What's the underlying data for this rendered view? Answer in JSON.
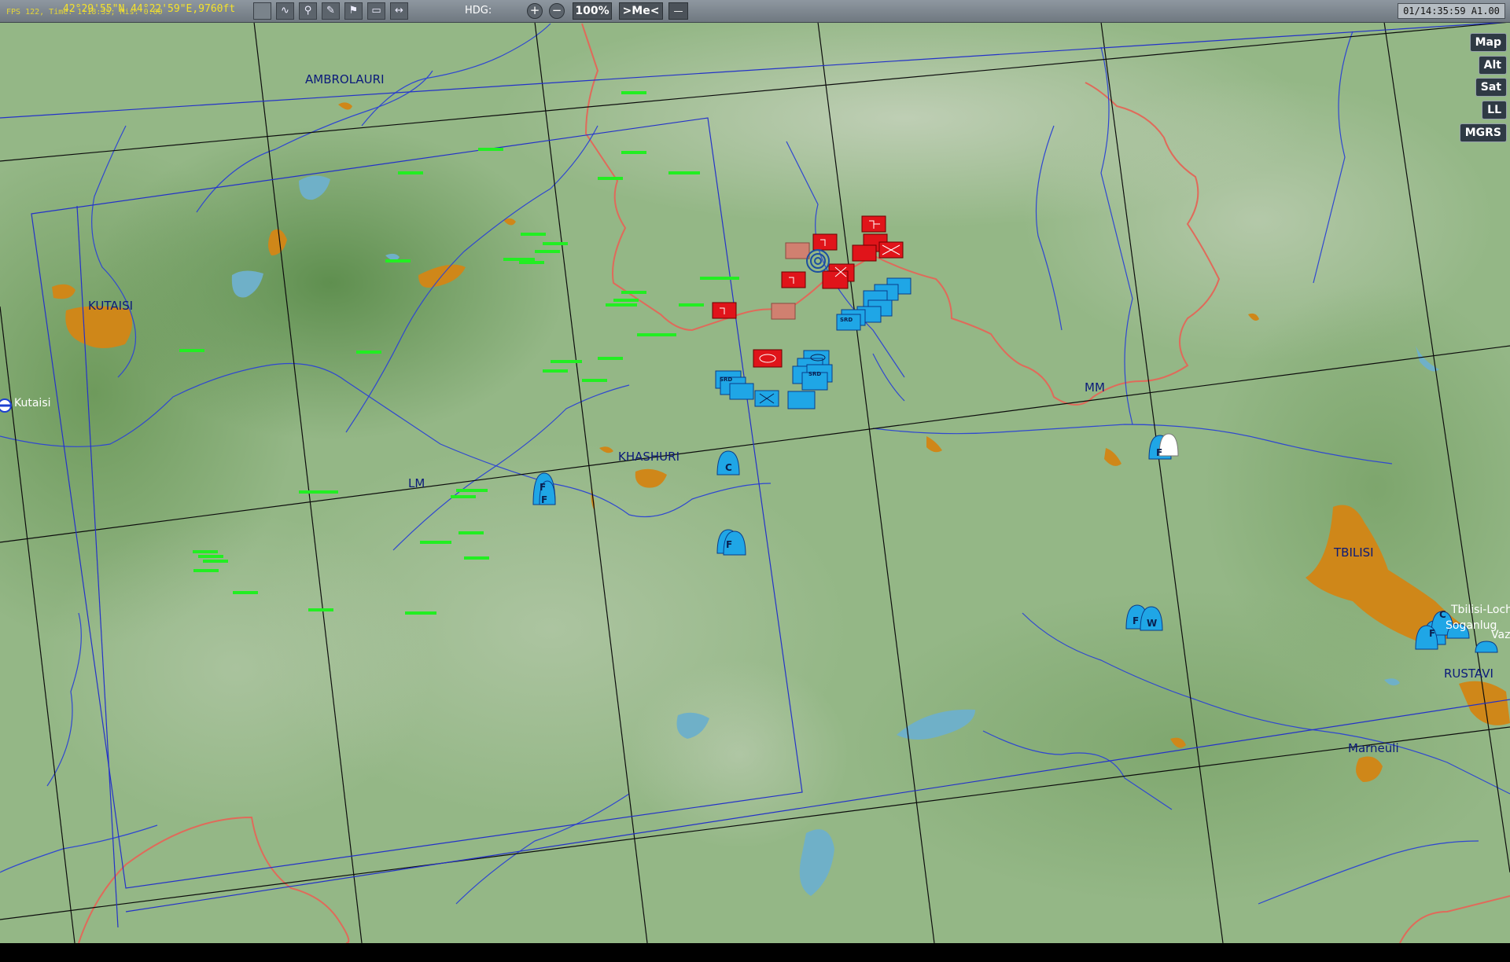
{
  "toolbar": {
    "app_tag": "MAP",
    "fps_text": "FPS   122, Time: 1:18:35; Mis: 0:00",
    "coords": "42°29'55\"N 44°22'59\"E,9760ft",
    "hdg_label": "HDG:",
    "zoom_in": "+",
    "zoom_out": "−",
    "zoom_level": "100%",
    "center_me": ">Me<",
    "ruler": "—",
    "clock": "01/14:35:59 A1.00",
    "tool_icons": [
      "route-icon",
      "measure-icon",
      "draw-icon",
      "mark-icon",
      "comment-icon",
      "ruler-icon"
    ]
  },
  "layers": [
    "Map",
    "Alt",
    "Sat",
    "LL",
    "MGRS"
  ],
  "cities": [
    {
      "name": "AMBROLAURI"
    },
    {
      "name": "KUTAISI"
    },
    {
      "name": "KHASHURI"
    },
    {
      "name": "TBILISI"
    },
    {
      "name": "RUSTAVI"
    },
    {
      "name": "Marneuli"
    }
  ],
  "airfields": [
    {
      "name": "Kutaisi"
    },
    {
      "name": "Tbilisi-Lochini"
    },
    {
      "name": "Soganlug"
    },
    {
      "name": "Vaziani"
    }
  ],
  "grid_labels": [
    "LM",
    "MM"
  ],
  "unit_labels": [
    "F",
    "C",
    "W",
    "SRD"
  ],
  "colors": {
    "friendly": "#1fa6e6",
    "enemy": "#e0141a",
    "city": "#cf8719",
    "river": "#243fcf",
    "border": "#e06a5a",
    "ground_units": "#22ee22",
    "terrain": "#8db07a"
  }
}
